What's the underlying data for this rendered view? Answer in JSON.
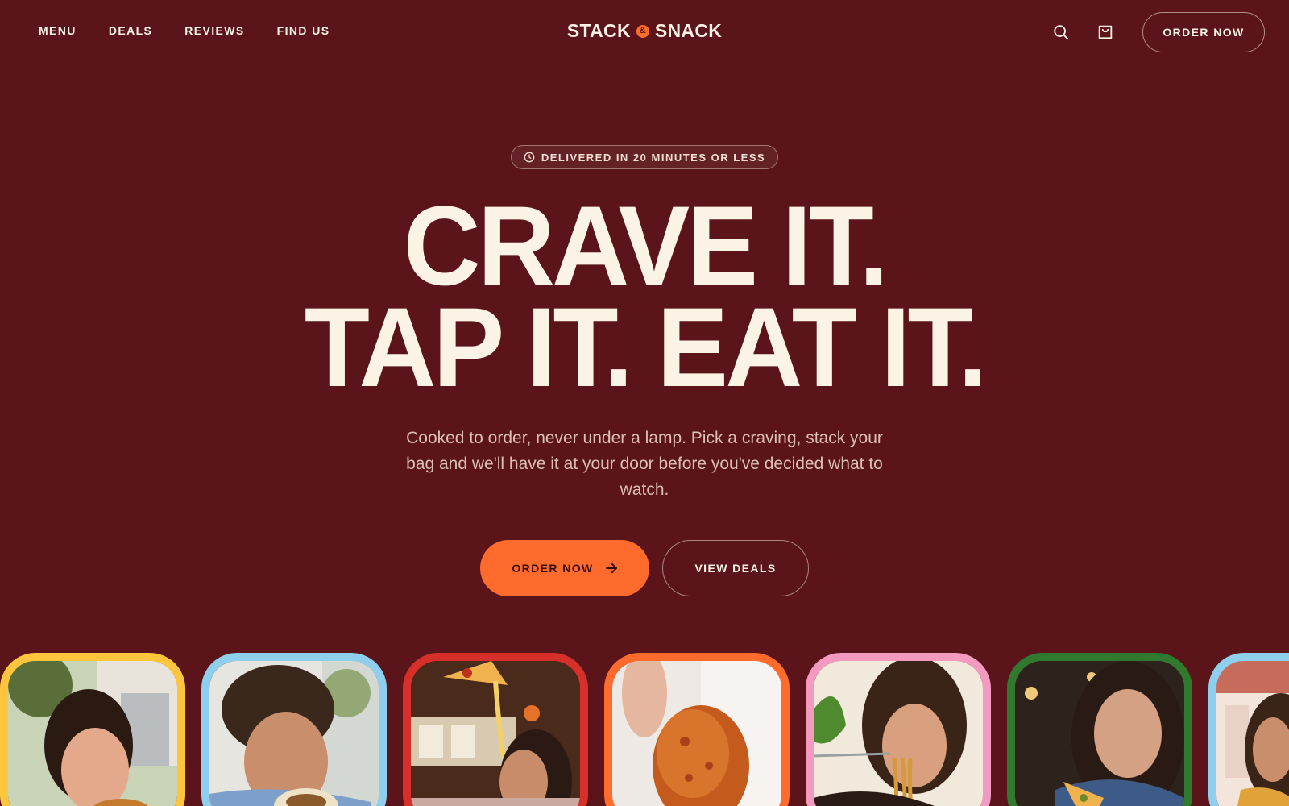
{
  "header": {
    "nav": [
      "Menu",
      "Deals",
      "Reviews",
      "Find Us"
    ],
    "logo_left": "STACK",
    "logo_amp": "&",
    "logo_right": "SNACK",
    "order_now_label": "Order Now"
  },
  "hero": {
    "badge": "Delivered in 20 minutes or less",
    "headline_line1": "CRAVE IT.",
    "headline_line2": "TAP IT. EAT IT.",
    "subcopy": "Cooked to order, never under a lamp. Pick a craving, stack your bag and we'll have it at your door before you've decided what to watch.",
    "primary_cta": "Order Now",
    "secondary_cta": "View Deals"
  },
  "gallery": {
    "cards": [
      {
        "name": "burger",
        "frame_color": "#ffc53d"
      },
      {
        "name": "burrito",
        "frame_color": "#8ecfee"
      },
      {
        "name": "pizza",
        "frame_color": "#d7302a"
      },
      {
        "name": "fried-chicken",
        "frame_color": "#ff6b2c"
      },
      {
        "name": "noodles",
        "frame_color": "#f49ac1"
      },
      {
        "name": "pizza-slice",
        "frame_color": "#2f7a2f"
      },
      {
        "name": "diner",
        "frame_color": "#8ecfee"
      }
    ]
  },
  "colors": {
    "background": "#5b151a",
    "accent": "#ff6b2c",
    "cream": "#fbf3e6"
  }
}
